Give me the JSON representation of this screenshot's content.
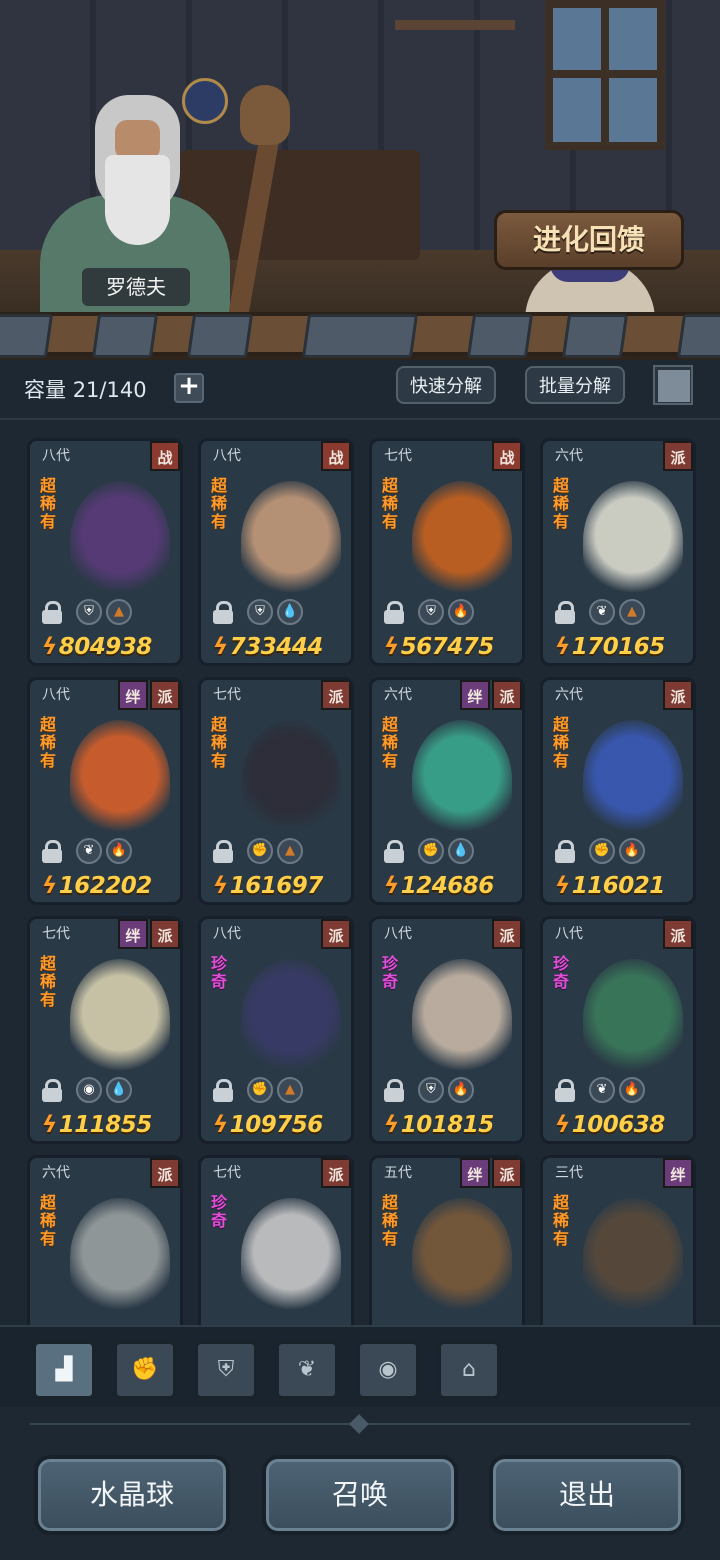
{
  "header": {
    "npc_name": "罗德夫",
    "evolve_feedback_label": "进化回馈"
  },
  "toolbar": {
    "capacity_label": "容量",
    "capacity_value": "21/140",
    "add_label": "+",
    "quick_decompose_label": "快速分解",
    "batch_decompose_label": "批量分解"
  },
  "cards": [
    {
      "gen": "八代",
      "tags": [
        "战"
      ],
      "rarity": "超稀有",
      "rarity_class": "sr",
      "element": "earth",
      "trait": "shield",
      "power": "804938",
      "art": "#5a3a7a"
    },
    {
      "gen": "八代",
      "tags": [
        "战"
      ],
      "rarity": "超稀有",
      "rarity_class": "sr",
      "element": "water",
      "trait": "shield",
      "power": "733444",
      "art": "#c49a7a"
    },
    {
      "gen": "七代",
      "tags": [
        "战"
      ],
      "rarity": "超稀有",
      "rarity_class": "sr",
      "element": "fire",
      "trait": "shield",
      "power": "567475",
      "art": "#c8621e"
    },
    {
      "gen": "六代",
      "tags": [
        "派"
      ],
      "rarity": "超稀有",
      "rarity_class": "sr",
      "element": "earth",
      "trait": "sprout",
      "power": "170165",
      "art": "#dcdcd0"
    },
    {
      "gen": "八代",
      "tags": [
        "绊",
        "派"
      ],
      "rarity": "超稀有",
      "rarity_class": "sr",
      "element": "fire",
      "trait": "sprout",
      "power": "162202",
      "art": "#d8602a"
    },
    {
      "gen": "七代",
      "tags": [
        "派"
      ],
      "rarity": "超稀有",
      "rarity_class": "sr",
      "element": "earth",
      "trait": "fist",
      "power": "161697",
      "art": "#2c2c36"
    },
    {
      "gen": "六代",
      "tags": [
        "绊",
        "派"
      ],
      "rarity": "超稀有",
      "rarity_class": "sr",
      "element": "water",
      "trait": "fist",
      "power": "124686",
      "art": "#3aa88e"
    },
    {
      "gen": "六代",
      "tags": [
        "派"
      ],
      "rarity": "超稀有",
      "rarity_class": "sr",
      "element": "fire",
      "trait": "fist",
      "power": "116021",
      "art": "#3a5ab8"
    },
    {
      "gen": "七代",
      "tags": [
        "绊",
        "派"
      ],
      "rarity": "超稀有",
      "rarity_class": "sr",
      "element": "water",
      "trait": "alien",
      "power": "111855",
      "art": "#d8d0b0"
    },
    {
      "gen": "八代",
      "tags": [
        "派"
      ],
      "rarity": "珍奇",
      "rarity_class": "r",
      "element": "earth",
      "trait": "fist",
      "power": "109756",
      "art": "#3a3a6a"
    },
    {
      "gen": "八代",
      "tags": [
        "派"
      ],
      "rarity": "珍奇",
      "rarity_class": "r",
      "element": "fire",
      "trait": "shield",
      "power": "101815",
      "art": "#c8b8a8"
    },
    {
      "gen": "八代",
      "tags": [
        "派"
      ],
      "rarity": "珍奇",
      "rarity_class": "r",
      "element": "fire",
      "trait": "sprout",
      "power": "100638",
      "art": "#3a7a5a"
    },
    {
      "gen": "六代",
      "tags": [
        "派"
      ],
      "rarity": "超稀有",
      "rarity_class": "sr",
      "element": "",
      "trait": "",
      "power": "",
      "art": "#9aa0a0"
    },
    {
      "gen": "七代",
      "tags": [
        "派"
      ],
      "rarity": "珍奇",
      "rarity_class": "r",
      "element": "",
      "trait": "",
      "power": "",
      "art": "#c8c8c8"
    },
    {
      "gen": "五代",
      "tags": [
        "绊",
        "派"
      ],
      "rarity": "超稀有",
      "rarity_class": "sr",
      "element": "",
      "trait": "",
      "power": "",
      "art": "#7a5a3a"
    },
    {
      "gen": "三代",
      "tags": [
        "绊"
      ],
      "rarity": "超稀有",
      "rarity_class": "sr",
      "element": "",
      "trait": "",
      "power": "",
      "art": "#5a4a3a"
    }
  ],
  "filter_tabs": [
    {
      "name": "all",
      "icon": "blocks-icon",
      "glyph": "▟",
      "active": true
    },
    {
      "name": "fist",
      "icon": "fist-icon",
      "glyph": "✊",
      "active": false
    },
    {
      "name": "shield",
      "icon": "shield-icon",
      "glyph": "⛨",
      "active": false
    },
    {
      "name": "sprout",
      "icon": "sprout-icon",
      "glyph": "❦",
      "active": false
    },
    {
      "name": "alien",
      "icon": "alien-icon",
      "glyph": "◉",
      "active": false
    },
    {
      "name": "tower",
      "icon": "tower-icon",
      "glyph": "⌂",
      "active": false
    }
  ],
  "bottom_buttons": {
    "crystal_ball": "水晶球",
    "summon": "召唤",
    "exit": "退出"
  },
  "colors": {
    "background": "#1d2833",
    "power_text": "#ffcf4a",
    "super_rare": "#ff9b2a",
    "rare": "#e04fd8",
    "tag_faction": "#7e3b33",
    "tag_bond": "#6a3d7a"
  }
}
